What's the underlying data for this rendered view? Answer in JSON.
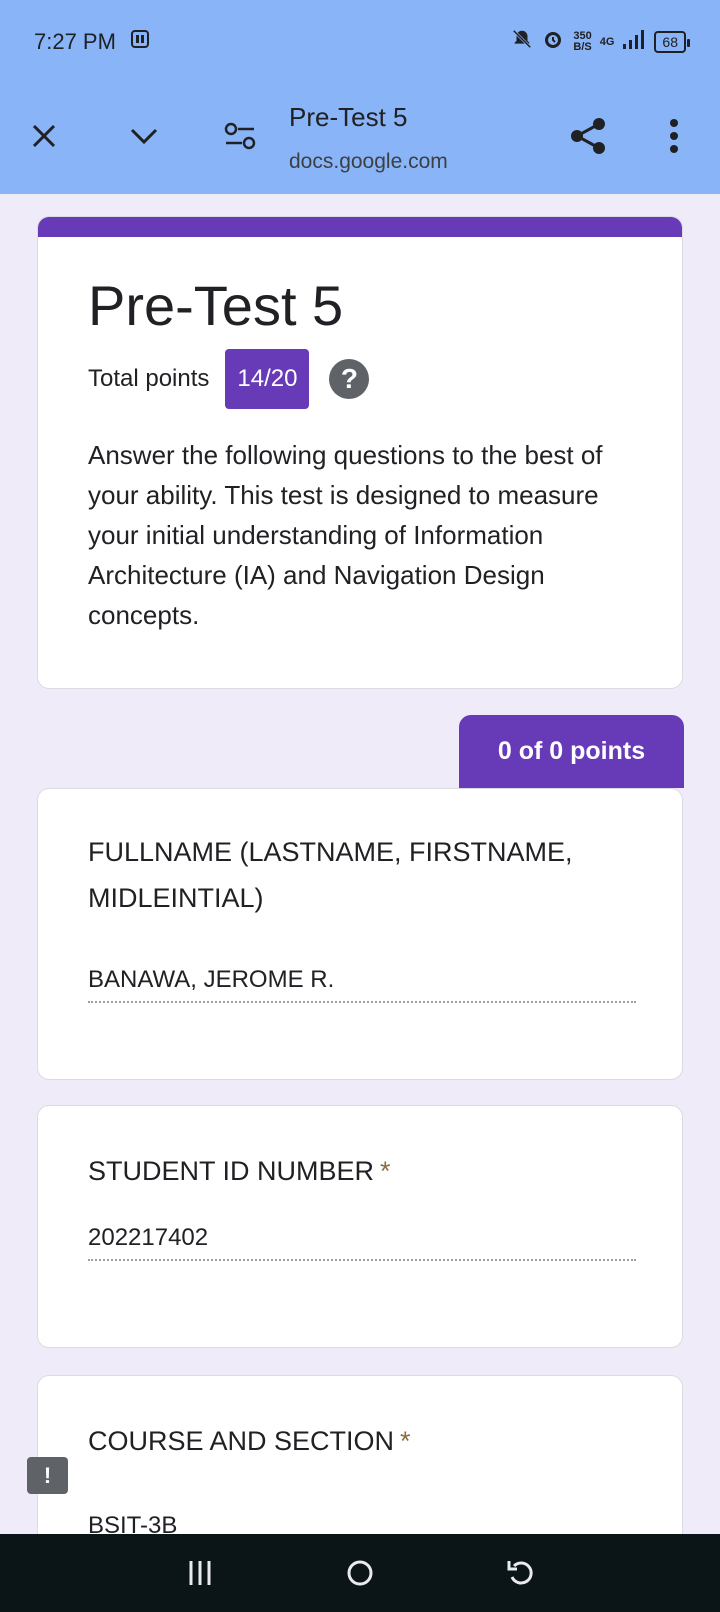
{
  "status": {
    "time": "7:27 PM",
    "net_speed_value": "350",
    "net_speed_unit": "B/S",
    "network": "4G",
    "battery": "68"
  },
  "toolbar": {
    "title": "Pre-Test 5",
    "url": "docs.google.com"
  },
  "form": {
    "title": "Pre-Test 5",
    "points_label": "Total points",
    "points_value": "14/20",
    "description": " Answer the following questions to the best of your ability. This test is designed to measure your initial understanding of Information Architecture (IA) and Navigation Design concepts."
  },
  "section": {
    "points": "0 of 0 points"
  },
  "questions": [
    {
      "title": "FULLNAME (LASTNAME, FIRSTNAME, MIDLEINTIAL)",
      "required_mark": "",
      "answer": "BANAWA, JEROME R."
    },
    {
      "title": "STUDENT ID NUMBER",
      "required_mark": "*",
      "answer": "202217402"
    },
    {
      "title": "COURSE AND SECTION",
      "required_mark": "*",
      "answer": "BSIT-3B"
    }
  ],
  "colors": {
    "accent": "#673ab7",
    "toolbar_bg": "#8ab4f8",
    "page_bg": "#f0ebf8"
  }
}
